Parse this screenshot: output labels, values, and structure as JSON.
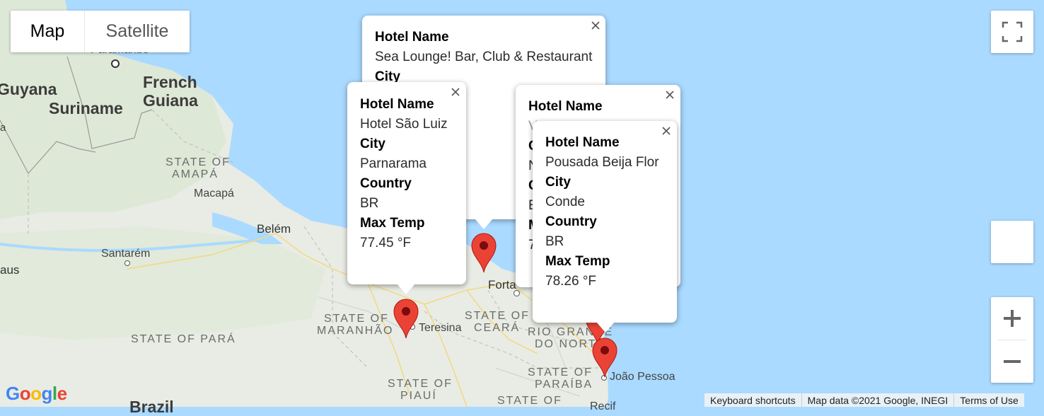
{
  "map_type": {
    "map_label": "Map",
    "satellite_label": "Satellite",
    "selected": "Map"
  },
  "labels": {
    "paramaribo": "Paramaribo",
    "guyana": "Guyana",
    "suriname": "Suriname",
    "french_guiana_1": "French",
    "french_guiana_2": "Guiana",
    "state_amapa_1": "STATE OF",
    "state_amapa_2": "AMAPÁ",
    "macapa": "Macapá",
    "belem": "Belém",
    "santarem": "Santarém",
    "manaus": "aus",
    "state_maranhao_1": "STATE OF",
    "state_maranhao_2": "MARANHÃO",
    "teresina": "Teresina",
    "state_ceara_1": "STATE OF",
    "state_ceara_2": "CEARÁ",
    "fortaleza": "Forta",
    "state_rgn_1": "RIO GRANDE",
    "state_rgn_2": "DO NORTE",
    "state_para": "STATE OF PARÁ",
    "state_paraiba_1": "STATE OF",
    "state_paraiba_2": "PARAÍBA",
    "joao_pessoa": "João Pessoa",
    "state_piaui_1": "STATE OF",
    "state_piaui_2": "PIAUÍ",
    "state_bottom": "STATE OF",
    "brazil": "Brazil",
    "recife": "Recif",
    "edge_a": "a"
  },
  "info_windows": [
    {
      "hotel_label": "Hotel Name",
      "hotel": "Sea Lounge! Bar, Club & Restaurant",
      "city_label": "City"
    },
    {
      "hotel_label": "Hotel Name",
      "hotel": "Hotel São Luiz",
      "city_label": "City",
      "city": "Parnarama",
      "country_label": "Country",
      "country": "BR",
      "temp_label": "Max Temp",
      "temp": "77.45 °F"
    },
    {
      "hotel_label": "Hotel Name",
      "partial_1": "V",
      "partial_2": "C",
      "partial_3": "N",
      "partial_4": "C",
      "partial_5": "E",
      "partial_6": "M",
      "partial_7": "7"
    },
    {
      "hotel_label": "Hotel Name",
      "hotel": "Pousada Beija Flor",
      "city_label": "City",
      "city": "Conde",
      "country_label": "Country",
      "country": "BR",
      "temp_label": "Max Temp",
      "temp": "78.26 °F"
    }
  ],
  "markers": [
    {
      "color": "#ea4335"
    },
    {
      "color": "#ea4335"
    },
    {
      "color": "#ea4335"
    },
    {
      "color": "#ea4335"
    }
  ],
  "footer": {
    "shortcuts": "Keyboard shortcuts",
    "map_data": "Map data ©2021 Google, INEGI",
    "terms": "Terms of Use"
  },
  "logo": {
    "letters": [
      "G",
      "o",
      "o",
      "g",
      "l",
      "e"
    ],
    "colors": [
      "#4285f4",
      "#ea4335",
      "#fbbc05",
      "#4285f4",
      "#34a853",
      "#ea4335"
    ]
  },
  "icons": {
    "fullscreen": "fullscreen-icon",
    "zoom_in": "zoom-in-icon",
    "zoom_out": "zoom-out-icon",
    "close": "close-icon",
    "marker": "map-pin-icon"
  }
}
